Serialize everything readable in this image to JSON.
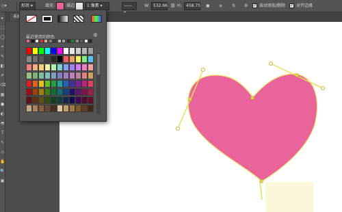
{
  "options_bar": {
    "shape_mode": "形状",
    "fill_label": "填充:",
    "fill_color": "#e8649b",
    "stroke_label": "描边:",
    "stroke_width": "1 像素",
    "w_label": "W:",
    "w_value": "532.66",
    "h_label": "H:",
    "h_value": "458.75",
    "auto_add_delete": "自动添加/删除",
    "align_edges": "对齐边缘"
  },
  "document_tab": {
    "label": "未标"
  },
  "swatch_popup": {
    "recent_label": "最近使用的颜色",
    "recent_colors": [
      "#e8649b",
      "#1a1a1a",
      "#f0e8d8",
      "#e03050",
      "#c8b8a0",
      "#808080",
      "#3a3a3a",
      "#c0c0c0",
      "#a0a0a0",
      "#303030",
      "#208040",
      "#909090",
      "#606060",
      "#f0f0f0",
      "#2a2a2a"
    ],
    "swatch_rows": [
      [
        "#ff0000",
        "#ffff00",
        "#00ff00",
        "#00ffff",
        "#0000ff",
        "#ff00ff",
        "#ffffff",
        "#e8e8e8",
        "#d0d0d0",
        "#b8b8b8",
        "#a0a0a0"
      ],
      [
        "#888888",
        "#707070",
        "#585858",
        "#404040",
        "#282828",
        "#000000",
        "#f06060",
        "#f0a060",
        "#f0f060",
        "#80f080",
        "#60c0f0"
      ],
      [
        "#f08080",
        "#f0b080",
        "#f0d080",
        "#f0f0a0",
        "#b0f0b0",
        "#80d0d0",
        "#80a0f0",
        "#a080f0",
        "#d080f0",
        "#f080c0",
        "#f0a0a0"
      ],
      [
        "#a0c080",
        "#80b080",
        "#80c0a0",
        "#80c0c0",
        "#80a0c0",
        "#8080c0",
        "#a080c0",
        "#c080c0",
        "#c080a0",
        "#e08080",
        "#d0a060"
      ],
      [
        "#e02020",
        "#e06020",
        "#e0c020",
        "#60c020",
        "#20a040",
        "#20a0a0",
        "#2060c0",
        "#4030a0",
        "#8020a0",
        "#c02080",
        "#e04060"
      ],
      [
        "#a01010",
        "#a04010",
        "#a08010",
        "#408010",
        "#107030",
        "#107070",
        "#104080",
        "#201070",
        "#601070",
        "#801050",
        "#a02040"
      ],
      [
        "#601010",
        "#603010",
        "#605010",
        "#305010",
        "#104020",
        "#104040",
        "#102850",
        "#100850",
        "#400850",
        "#500830",
        "#601020"
      ],
      [
        "#c8a880",
        "#a88060",
        "#886040",
        "#684830",
        "#483020",
        "#e0c8a0",
        "#c0a070",
        "#a07840",
        "#805830",
        "#604020",
        "#402818"
      ]
    ]
  },
  "tools": [
    "▸",
    "⬚",
    "◯",
    "⌖",
    "✎",
    "◧",
    "✐",
    "⌫",
    "▦",
    "●",
    "◐",
    "◓",
    "T",
    "↖",
    "◇",
    "✋",
    "🔍",
    "▣"
  ],
  "shape": {
    "fill": "#e8649b",
    "stroke": "#f0dc64"
  },
  "colors": {
    "panel_bg": "#535353",
    "dark_bg": "#4d4d4d",
    "canvas": "#ffffff",
    "handle": "#e8de5a"
  }
}
